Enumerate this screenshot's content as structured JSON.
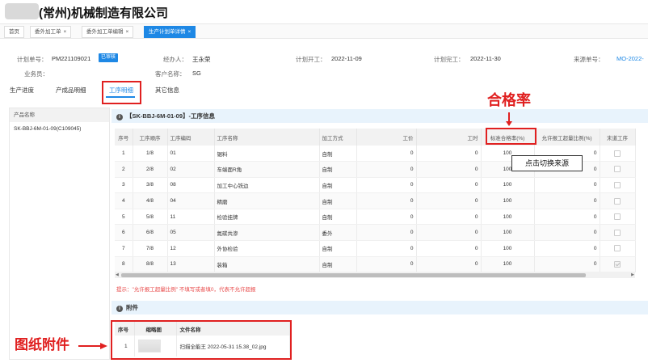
{
  "header": {
    "company": "(常州)机械制造有限公司"
  },
  "tabs": [
    {
      "label": "首页"
    },
    {
      "label": "委外加工单",
      "close": "×"
    },
    {
      "label": "委外加工单编辑",
      "close": "×"
    },
    {
      "label": "生产计划单详情",
      "close": "×"
    }
  ],
  "fields": {
    "plan_no_label": "计划单号：",
    "plan_no": "PM221109021",
    "status_badge": "已审核",
    "handler_label": "经办人：",
    "handler": "王永荣",
    "plan_start_label": "计划开工：",
    "plan_start": "2022-11-09",
    "plan_end_label": "计划完工：",
    "plan_end": "2022-11-30",
    "source_no_label": "来源单号：",
    "source_no": "MO-2022-",
    "salesman_label": "业务员：",
    "customer_label": "客户名称：",
    "customer": "SG"
  },
  "subtabs": [
    "生产进度",
    "产成品明细",
    "工序明细",
    "其它信息"
  ],
  "left_panel": {
    "header": "产品名称",
    "item": "SK-BBJ-6M-01-09(C109045)"
  },
  "process_section": {
    "title": "【SK-BBJ-6M-01-09】-工序信息",
    "icon": "i",
    "columns": [
      "序号",
      "工序顺序",
      "工序编码",
      "工序名称",
      "加工方式",
      "工价",
      "工时",
      "标准合格率(%)",
      "允许报工超量比例(%)",
      "末道工序"
    ],
    "rows": [
      [
        "1",
        "1/8",
        "01",
        "锯料",
        "自制",
        "0",
        "0",
        "100",
        "0",
        ""
      ],
      [
        "2",
        "2/8",
        "02",
        "车端面R角",
        "自制",
        "0",
        "0",
        "100",
        "0",
        ""
      ],
      [
        "3",
        "3/8",
        "08",
        "加工中心铣边",
        "自制",
        "0",
        "0",
        "100",
        "0",
        ""
      ],
      [
        "4",
        "4/8",
        "04",
        "精磨",
        "自制",
        "0",
        "0",
        "100",
        "0",
        ""
      ],
      [
        "5",
        "5/8",
        "11",
        "检验挂牌",
        "自制",
        "0",
        "0",
        "100",
        "0",
        ""
      ],
      [
        "6",
        "6/8",
        "05",
        "氮碳共渗",
        "委外",
        "0",
        "0",
        "100",
        "0",
        ""
      ],
      [
        "7",
        "7/8",
        "12",
        "外协检验",
        "自制",
        "0",
        "0",
        "100",
        "0",
        ""
      ],
      [
        "8",
        "8/8",
        "13",
        "装箱",
        "自制",
        "0",
        "0",
        "100",
        "0",
        "checked"
      ]
    ]
  },
  "hint": "提示：\"允许报工超量比例\" 不填写或者填0，代表不允许超报",
  "attachments": {
    "title": "附件",
    "icon": "i",
    "columns": [
      "序号",
      "缩略图",
      "文件名称"
    ],
    "rows": [
      {
        "index": "1",
        "filename": "扫描全能王 2022-05-31 15.38_02.jpg"
      }
    ]
  },
  "annotations": {
    "pass_rate": "合格率",
    "tooltip": "点击切换来源",
    "attachments": "图纸附件",
    "color": "#e02020"
  },
  "colors": {
    "accent": "#1e88e5",
    "warning": "#e84a4a"
  }
}
